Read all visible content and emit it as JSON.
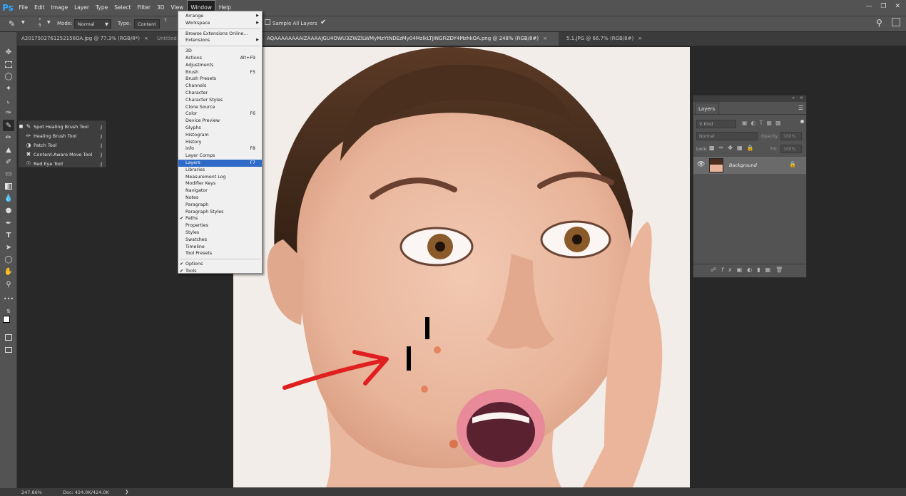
{
  "app": {
    "logo": "Ps"
  },
  "menubar": {
    "items": [
      "File",
      "Edit",
      "Image",
      "Layer",
      "Type",
      "Select",
      "Filter",
      "3D",
      "View",
      "Window",
      "Help"
    ],
    "active": "Window"
  },
  "options_bar": {
    "brush_size": "5",
    "mode_label": "Mode:",
    "mode_value": "Normal",
    "type_label": "Type:",
    "type_value": "Content",
    "sample_all_layers": "Sample All Layers"
  },
  "tabs": [
    {
      "label": "A2017502761252156OA.jpg @ 77.3% (RGB/8*)",
      "active": false
    },
    {
      "label": "Untitled-1",
      "active": false
    },
    {
      "label": "AQAAAAAAAAiZAAAAJGU4OWU3ZWZlLWMyMzYtNDEzMy04MzlkLTJiNGFiZDY4MzhkOA.png @ 248% (RGB/8#)",
      "active": true
    },
    {
      "label": "5.1.JPG @ 66.7% (RGB/8#)",
      "active": false
    }
  ],
  "tool_flyout": {
    "items": [
      {
        "label": "Spot Healing Brush Tool",
        "key": "J",
        "selected": true,
        "icon": "spot-healing-icon"
      },
      {
        "label": "Healing Brush Tool",
        "key": "J",
        "selected": false,
        "icon": "healing-brush-icon"
      },
      {
        "label": "Patch Tool",
        "key": "J",
        "selected": false,
        "icon": "patch-icon"
      },
      {
        "label": "Content-Aware Move Tool",
        "key": "J",
        "selected": false,
        "icon": "content-aware-move-icon"
      },
      {
        "label": "Red Eye Tool",
        "key": "J",
        "selected": false,
        "icon": "red-eye-icon"
      }
    ]
  },
  "window_menu": {
    "items": [
      {
        "label": "Arrange",
        "shortcut": "",
        "submenu": true
      },
      {
        "label": "Workspace",
        "shortcut": "",
        "submenu": true
      },
      {
        "sep": true
      },
      {
        "label": "Browse Extensions Online...",
        "shortcut": ""
      },
      {
        "label": "Extensions",
        "shortcut": "",
        "submenu": true
      },
      {
        "sep": true
      },
      {
        "label": "3D",
        "shortcut": ""
      },
      {
        "label": "Actions",
        "shortcut": "Alt+F9"
      },
      {
        "label": "Adjustments",
        "shortcut": ""
      },
      {
        "label": "Brush",
        "shortcut": "F5"
      },
      {
        "label": "Brush Presets",
        "shortcut": ""
      },
      {
        "label": "Channels",
        "shortcut": ""
      },
      {
        "label": "Character",
        "shortcut": ""
      },
      {
        "label": "Character Styles",
        "shortcut": ""
      },
      {
        "label": "Clone Source",
        "shortcut": ""
      },
      {
        "label": "Color",
        "shortcut": "F6"
      },
      {
        "label": "Device Preview",
        "shortcut": ""
      },
      {
        "label": "Glyphs",
        "shortcut": ""
      },
      {
        "label": "Histogram",
        "shortcut": ""
      },
      {
        "label": "History",
        "shortcut": ""
      },
      {
        "label": "Info",
        "shortcut": "F8"
      },
      {
        "label": "Layer Comps",
        "shortcut": ""
      },
      {
        "label": "Layers",
        "shortcut": "F7",
        "highlighted": true
      },
      {
        "label": "Libraries",
        "shortcut": ""
      },
      {
        "label": "Measurement Log",
        "shortcut": ""
      },
      {
        "label": "Modifier Keys",
        "shortcut": ""
      },
      {
        "label": "Navigator",
        "shortcut": ""
      },
      {
        "label": "Notes",
        "shortcut": ""
      },
      {
        "label": "Paragraph",
        "shortcut": ""
      },
      {
        "label": "Paragraph Styles",
        "shortcut": ""
      },
      {
        "label": "Paths",
        "shortcut": "",
        "checked": true
      },
      {
        "label": "Properties",
        "shortcut": ""
      },
      {
        "label": "Styles",
        "shortcut": ""
      },
      {
        "label": "Swatches",
        "shortcut": ""
      },
      {
        "label": "Timeline",
        "shortcut": ""
      },
      {
        "label": "Tool Presets",
        "shortcut": ""
      },
      {
        "sep": true
      },
      {
        "label": "Options",
        "shortcut": "",
        "checked": true
      },
      {
        "label": "Tools",
        "shortcut": "",
        "checked": true
      }
    ]
  },
  "layers_panel": {
    "title": "Layers",
    "filter_kind": "Kind",
    "blend_mode": "Normal",
    "opacity_label": "Opacity:",
    "opacity_value": "100%",
    "lock_label": "Lock:",
    "fill_label": "Fill:",
    "fill_value": "100%",
    "layers": [
      {
        "name": "Background",
        "visible": true,
        "locked": true
      }
    ]
  },
  "status": {
    "zoom": "247.86%",
    "doc": "Doc: 424.0K/424.0K"
  },
  "colors": {
    "accent": "#2e6ac7",
    "annotation_red": "#e02020"
  }
}
